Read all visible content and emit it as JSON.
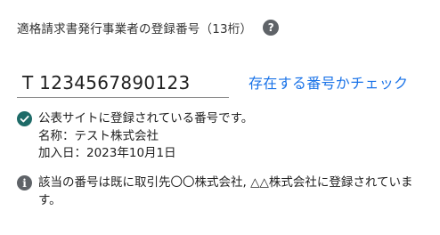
{
  "registration": {
    "label": "適格請求書発行事業者の登録番号（13桁）",
    "help_icon": "?",
    "input_value": "T 1234567890123",
    "check_link": "存在する番号かチェック"
  },
  "result": {
    "status_icon": "check-circle",
    "status_color": "#1e6b68",
    "message": "公表サイトに登録されている番号です。",
    "name_line": "名称：テスト株式会社",
    "date_line": "加入日：2023年10月1日"
  },
  "notice": {
    "icon": "info-circle",
    "text": "該当の番号は既に取引先〇〇株式会社, △△株式会社に登録されています。"
  },
  "colors": {
    "link": "#1a73e8",
    "icon_gray": "#5f6368"
  }
}
